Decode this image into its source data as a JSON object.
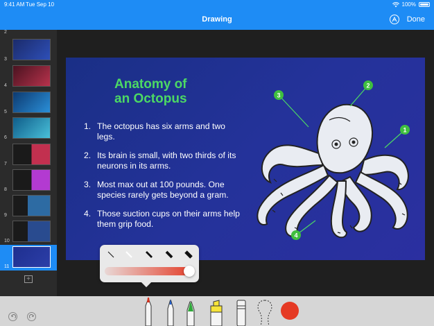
{
  "status_bar": {
    "time": "9:41 AM",
    "date": "Tue Sep 10",
    "battery": "100%",
    "battery_level": 1.0
  },
  "nav_bar": {
    "title": "Drawing",
    "done_label": "Done"
  },
  "sidebar": {
    "slides": [
      {
        "number": "2"
      },
      {
        "number": "3"
      },
      {
        "number": "4"
      },
      {
        "number": "5"
      },
      {
        "number": "6"
      },
      {
        "number": "7"
      },
      {
        "number": "8"
      },
      {
        "number": "9"
      },
      {
        "number": "10"
      },
      {
        "number": "11",
        "selected": true
      }
    ],
    "add_label": "+"
  },
  "slide": {
    "title_line1": "Anatomy of",
    "title_line2": "an Octopus",
    "items": [
      {
        "n": "1.",
        "text": "The octopus has six arms and two legs."
      },
      {
        "n": "2.",
        "text": "Its brain is small, with two thirds of its neurons in its arms."
      },
      {
        "n": "3.",
        "text": "Most max out at 100 pounds. One species rarely gets beyond a gram."
      },
      {
        "n": "4.",
        "text": "Those suction cups on their arms help them grip food."
      }
    ],
    "callouts": [
      "1",
      "2",
      "3",
      "4"
    ]
  },
  "stroke_popover": {
    "selected_index": 1,
    "opacity": 1.0
  },
  "tools": [
    "undo",
    "redo",
    "marker",
    "pen",
    "crayon",
    "highlighter",
    "eraser",
    "lasso"
  ],
  "colors": {
    "accent": "#1e8cf5",
    "title_green": "#4cd964",
    "ink": "#e53a24",
    "slide_bg": "#24329a"
  }
}
